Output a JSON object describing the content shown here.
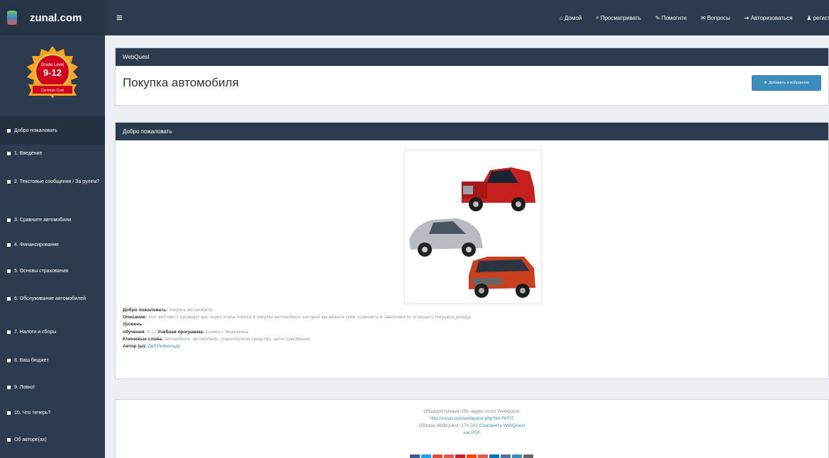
{
  "brand": {
    "name": "zunal.com"
  },
  "topnav": [
    {
      "icon": "home-icon",
      "glyph": "⌂",
      "label": "Домой"
    },
    {
      "icon": "search-icon",
      "glyph": "⌕",
      "label": "Просматривать"
    },
    {
      "icon": "help-icon",
      "glyph": "✎",
      "label": "Помогите"
    },
    {
      "icon": "comments-icon",
      "glyph": "✉",
      "label": "Вопросы"
    },
    {
      "icon": "login-icon",
      "glyph": "➜",
      "label": "Авторизоваться"
    },
    {
      "icon": "user-icon",
      "glyph": "♟",
      "label": "регистр"
    }
  ],
  "badge": {
    "top": "Grade Level",
    "grade": "9-12",
    "ribbon": "Common Core"
  },
  "sidebar": {
    "items": [
      {
        "label": "Добро пожаловать",
        "active": true
      },
      {
        "label": "1. Введение"
      },
      {
        "label": "2. Текстовые сообщения / За рулем?"
      },
      {
        "label": "3. Сравните автомобили"
      },
      {
        "label": "4. Финансирование"
      },
      {
        "label": "5. Основы страхования"
      },
      {
        "label": "6. Обслуживание автомобилей"
      },
      {
        "label": "7. Налоги и сборы"
      },
      {
        "label": "8. Ваш бюджет"
      },
      {
        "label": "9. Ловко!"
      },
      {
        "label": "10. Что теперь?"
      },
      {
        "label": "Об авторе(ах)"
      }
    ]
  },
  "webquest_panel": {
    "header": "WebQuest",
    "title": "Покупка автомобиля",
    "favorite_button": "Добавить в избранное"
  },
  "welcome_panel": {
    "header": "Добро пожаловать",
    "info": {
      "welcome_label": "Добро пожаловать:",
      "welcome_value": "покупка автомобиля",
      "description_label": "Описание:",
      "description_value": "этот веб-квест проведет вас через этапы поиска и покупки автомобиля, который вы можете себе позволить в зависимости от вашего текущего дохода.",
      "level_label": "Уровень",
      "grades_label": "обучения",
      "grades_value": ": 9-12",
      "curriculum_label": "Учебная программа:",
      "curriculum_value": "Бизнес / Экономика",
      "keywords_label": "Ключевые слова:",
      "keywords_value": "автомобиль, автомобиль, транспортное средство, автострахование",
      "author_label": "Автор (ы):",
      "author_value": "Деб Рейнольдс"
    }
  },
  "footer": {
    "public_url_label": "Общедоступный URL-адрес этого WebQuest:",
    "public_url": "http://zunal.com/webquest.php?w=76707",
    "views_text": "Обзоры WebQuest: 174 282",
    "save_link": "Сохранить WebQuest",
    "as_pdf": "как PDF"
  },
  "colors": {
    "topbar": "#2c3b4d",
    "page_bg": "#ecf0f5",
    "button": "#3c8dbc",
    "share": [
      "#3b5998",
      "#1da1f2",
      "#dd4b39",
      "#e05a4f",
      "#cb2027",
      "#ff4500",
      "#0077b5",
      "#4c75a3",
      "#3c8dbc",
      "#666666"
    ]
  }
}
